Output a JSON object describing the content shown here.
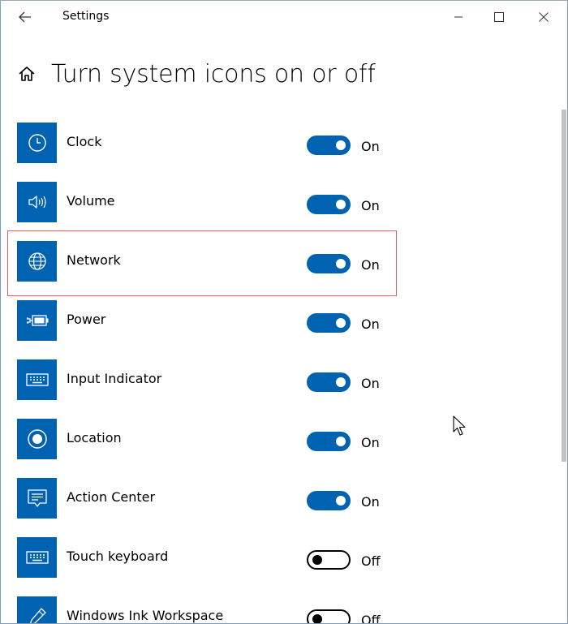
{
  "window": {
    "title": "Settings"
  },
  "page": {
    "title": "Turn system icons on or off"
  },
  "items": [
    {
      "label": "Clock",
      "state": "On",
      "icon": "clock-icon"
    },
    {
      "label": "Volume",
      "state": "On",
      "icon": "volume-icon"
    },
    {
      "label": "Network",
      "state": "On",
      "icon": "network-globe-icon"
    },
    {
      "label": "Power",
      "state": "On",
      "icon": "battery-plug-icon"
    },
    {
      "label": "Input Indicator",
      "state": "On",
      "icon": "keyboard-icon"
    },
    {
      "label": "Location",
      "state": "On",
      "icon": "location-icon"
    },
    {
      "label": "Action Center",
      "state": "On",
      "icon": "action-center-icon"
    },
    {
      "label": "Touch keyboard",
      "state": "Off",
      "icon": "keyboard-icon"
    },
    {
      "label": "Windows Ink Workspace",
      "state": "Off",
      "icon": "pen-icon"
    }
  ],
  "colors": {
    "accent": "#0063b1",
    "highlight": "#e06060"
  }
}
